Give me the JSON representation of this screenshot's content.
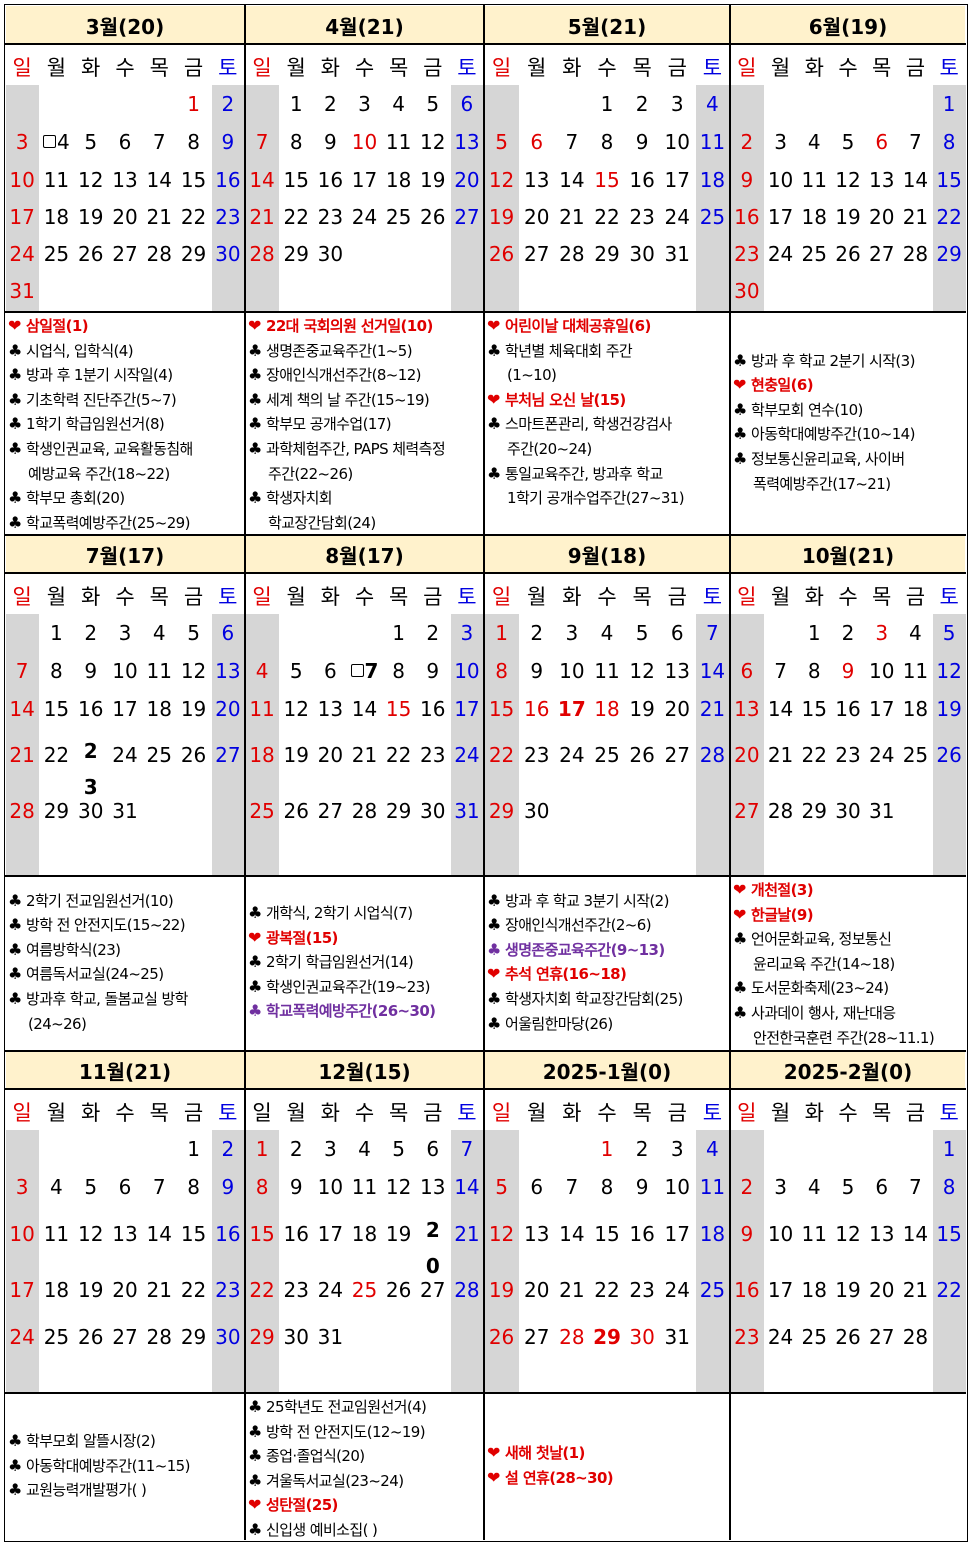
{
  "weekday_labels": [
    "일",
    "월",
    "화",
    "수",
    "목",
    "금",
    "토"
  ],
  "colors": {
    "header_bg": "#fff2cc",
    "weekend_column": "#d6d6d6",
    "holiday": "#e00000",
    "saturday": "#0000e0",
    "highlight_purple": "#7030a0"
  },
  "months": [
    {
      "title": "3월(20)",
      "sat_blue": true,
      "weeks": [
        [
          null,
          null,
          null,
          null,
          null,
          "1",
          "2"
        ],
        [
          "3",
          {
            "n": "4",
            "box": true
          },
          "5",
          "6",
          "7",
          "8",
          "9"
        ],
        [
          "10",
          "11",
          "12",
          "13",
          "14",
          "15",
          "16"
        ],
        [
          "17",
          "18",
          "19",
          "20",
          "21",
          "22",
          "23"
        ],
        [
          "24",
          "25",
          "26",
          "27",
          "28",
          "29",
          "30"
        ],
        [
          "31",
          null,
          null,
          null,
          null,
          null,
          null
        ]
      ],
      "red_days": [
        "1"
      ],
      "bold_days": []
    },
    {
      "title": "4월(21)",
      "sat_blue": true,
      "weeks": [
        [
          null,
          "1",
          "2",
          "3",
          "4",
          "5",
          "6"
        ],
        [
          "7",
          "8",
          "9",
          "10",
          "11",
          "12",
          "13"
        ],
        [
          "14",
          "15",
          "16",
          "17",
          "18",
          "19",
          "20"
        ],
        [
          "21",
          "22",
          "23",
          "24",
          "25",
          "26",
          "27"
        ],
        [
          "28",
          "29",
          "30",
          null,
          null,
          null,
          null
        ]
      ],
      "red_days": [
        "10"
      ],
      "bold_days": []
    },
    {
      "title": "5월(21)",
      "sat_blue": true,
      "weeks": [
        [
          null,
          null,
          null,
          "1",
          "2",
          "3",
          "4"
        ],
        [
          "5",
          "6",
          "7",
          "8",
          "9",
          "10",
          "11"
        ],
        [
          "12",
          "13",
          "14",
          "15",
          "16",
          "17",
          "18"
        ],
        [
          "19",
          "20",
          "21",
          "22",
          "23",
          "24",
          "25"
        ],
        [
          "26",
          "27",
          "28",
          "29",
          "30",
          "31",
          null
        ]
      ],
      "red_days": [
        "6",
        "15"
      ],
      "bold_days": []
    },
    {
      "title": "6월(19)",
      "sat_blue": true,
      "weeks": [
        [
          null,
          null,
          null,
          null,
          null,
          null,
          "1"
        ],
        [
          "2",
          "3",
          "4",
          "5",
          "6",
          "7",
          "8"
        ],
        [
          "9",
          "10",
          "11",
          "12",
          "13",
          "14",
          "15"
        ],
        [
          "16",
          "17",
          "18",
          "19",
          "20",
          "21",
          "22"
        ],
        [
          "23",
          "24",
          "25",
          "26",
          "27",
          "28",
          "29"
        ],
        [
          "30",
          null,
          null,
          null,
          null,
          null,
          null
        ]
      ],
      "red_days": [
        "6"
      ],
      "bold_days": []
    },
    {
      "title": "7월(17)",
      "sat_blue": true,
      "weeks": [
        [
          null,
          "1",
          "2",
          "3",
          "4",
          "5",
          "6"
        ],
        [
          "7",
          "8",
          "9",
          "10",
          "11",
          "12",
          "13"
        ],
        [
          "14",
          "15",
          "16",
          "17",
          "18",
          "19",
          "20"
        ],
        [
          "21",
          "22",
          {
            "n": "23",
            "split": [
              "2",
              "3"
            ],
            "bold": true
          },
          "24",
          "25",
          "26",
          "27"
        ],
        [
          "28",
          "29",
          "30",
          "31",
          null,
          null,
          null
        ]
      ],
      "red_days": [],
      "bold_days": [
        "23"
      ]
    },
    {
      "title": "8월(17)",
      "sat_blue": true,
      "weeks": [
        [
          null,
          null,
          null,
          null,
          "1",
          "2",
          "3"
        ],
        [
          "4",
          "5",
          "6",
          {
            "n": "7",
            "box": true,
            "bold": true
          },
          "8",
          "9",
          "10"
        ],
        [
          "11",
          "12",
          "13",
          "14",
          "15",
          "16",
          "17"
        ],
        [
          "18",
          "19",
          "20",
          "21",
          "22",
          "23",
          "24"
        ],
        [
          "25",
          "26",
          "27",
          "28",
          "29",
          "30",
          "31"
        ]
      ],
      "red_days": [
        "15"
      ],
      "bold_days": [
        "7"
      ]
    },
    {
      "title": "9월(18)",
      "sat_blue": true,
      "weeks": [
        [
          "1",
          "2",
          "3",
          "4",
          "5",
          "6",
          "7"
        ],
        [
          "8",
          "9",
          "10",
          "11",
          "12",
          "13",
          "14"
        ],
        [
          "15",
          "16",
          "17",
          "18",
          "19",
          "20",
          "21"
        ],
        [
          "22",
          "23",
          "24",
          "25",
          "26",
          "27",
          "28"
        ],
        [
          "29",
          "30",
          null,
          null,
          null,
          null,
          null
        ]
      ],
      "red_days": [
        "16",
        "17",
        "18"
      ],
      "bold_days": [
        "17"
      ]
    },
    {
      "title": "10월(21)",
      "sat_blue": true,
      "weeks": [
        [
          null,
          null,
          "1",
          "2",
          "3",
          "4",
          "5"
        ],
        [
          "6",
          "7",
          "8",
          "9",
          "10",
          "11",
          "12"
        ],
        [
          "13",
          "14",
          "15",
          "16",
          "17",
          "18",
          "19"
        ],
        [
          "20",
          "21",
          "22",
          "23",
          "24",
          "25",
          "26"
        ],
        [
          "27",
          "28",
          "29",
          "30",
          "31",
          null,
          null
        ]
      ],
      "red_days": [
        "3",
        "9"
      ],
      "bold_days": []
    },
    {
      "title": "11월(21)",
      "sat_blue": true,
      "weeks": [
        [
          null,
          null,
          null,
          null,
          null,
          "1",
          "2"
        ],
        [
          "3",
          "4",
          "5",
          "6",
          "7",
          "8",
          "9"
        ],
        [
          "10",
          "11",
          "12",
          "13",
          "14",
          "15",
          "16"
        ],
        [
          "17",
          "18",
          "19",
          "20",
          "21",
          "22",
          "23"
        ],
        [
          "24",
          "25",
          "26",
          "27",
          "28",
          "29",
          "30"
        ]
      ],
      "red_days": [],
      "bold_days": []
    },
    {
      "title": "12월(15)",
      "sat_blue": true,
      "sun_black_label": true,
      "weeks": [
        [
          "1",
          "2",
          "3",
          "4",
          "5",
          "6",
          "7"
        ],
        [
          "8",
          "9",
          "10",
          "11",
          "12",
          "13",
          "14"
        ],
        [
          "15",
          "16",
          "17",
          "18",
          "19",
          {
            "n": "20",
            "split": [
              "2",
              "0"
            ],
            "bold": true
          },
          "21"
        ],
        [
          "22",
          "23",
          "24",
          "25",
          "26",
          "27",
          "28"
        ],
        [
          "29",
          "30",
          "31",
          null,
          null,
          null,
          null
        ]
      ],
      "red_days": [
        "25"
      ],
      "bold_days": [
        "20"
      ]
    },
    {
      "title": "2025-1월(0)",
      "sat_blue": true,
      "weeks": [
        [
          null,
          null,
          null,
          "1",
          "2",
          "3",
          "4"
        ],
        [
          "5",
          "6",
          "7",
          "8",
          "9",
          "10",
          "11"
        ],
        [
          "12",
          "13",
          "14",
          "15",
          "16",
          "17",
          "18"
        ],
        [
          "19",
          "20",
          "21",
          "22",
          "23",
          "24",
          "25"
        ],
        [
          "26",
          "27",
          "28",
          "29",
          "30",
          "31",
          null
        ]
      ],
      "red_days": [
        "1",
        "28",
        "29",
        "30"
      ],
      "bold_days": [
        "29"
      ]
    },
    {
      "title": "2025-2월(0)",
      "sat_blue": true,
      "weeks": [
        [
          null,
          null,
          null,
          null,
          null,
          null,
          "1"
        ],
        [
          "2",
          "3",
          "4",
          "5",
          "6",
          "7",
          "8"
        ],
        [
          "9",
          "10",
          "11",
          "12",
          "13",
          "14",
          "15"
        ],
        [
          "16",
          "17",
          "18",
          "19",
          "20",
          "21",
          "22"
        ],
        [
          "23",
          "24",
          "25",
          "26",
          "27",
          "28",
          null
        ]
      ],
      "red_days": [],
      "bold_days": []
    }
  ],
  "events": [
    [
      {
        "icon": "heart",
        "text": "삼일절(1)",
        "style": "red"
      },
      {
        "icon": "club",
        "text": "시업식, 입학식(4)"
      },
      {
        "icon": "club",
        "text": "방과 후 1분기 시작일(4)"
      },
      {
        "icon": "club",
        "text": "기초학력 진단주간(5~7)"
      },
      {
        "icon": "club",
        "text": "1학기 학급임원선거(8)"
      },
      {
        "icon": "club",
        "text": "학생인권교육, 교육활동침해"
      },
      {
        "icon": "",
        "text": "예방교육 주간(18~22)"
      },
      {
        "icon": "club",
        "text": "학부모 총회(20)"
      },
      {
        "icon": "club",
        "text": "학교폭력예방주간(25~29)"
      }
    ],
    [
      {
        "icon": "heart",
        "text": "22대 국회의원 선거일(10)",
        "style": "red"
      },
      {
        "icon": "club",
        "text": "생명존중교육주간(1~5)"
      },
      {
        "icon": "club",
        "text": "장애인식개선주간(8~12)"
      },
      {
        "icon": "club",
        "text": "세계 책의 날 주간(15~19)"
      },
      {
        "icon": "club",
        "text": "학부모 공개수업(17)"
      },
      {
        "icon": "club",
        "text": "과학체험주간, PAPS 체력측정"
      },
      {
        "icon": "",
        "text": "주간(22~26)"
      },
      {
        "icon": "club",
        "text": "학생자치회"
      },
      {
        "icon": "",
        "text": "학교장간담회(24)"
      }
    ],
    [
      {
        "icon": "heart",
        "text": "어린이날 대체공휴일(6)",
        "style": "red"
      },
      {
        "icon": "club",
        "text": "학년별 체육대회 주간"
      },
      {
        "icon": "",
        "text": "(1~10)"
      },
      {
        "icon": "heart",
        "text": "부처님 오신 날(15)",
        "style": "red"
      },
      {
        "icon": "club",
        "text": "스마트폰관리, 학생건강검사"
      },
      {
        "icon": "",
        "text": "주간(20~24)"
      },
      {
        "icon": "club",
        "text": "통일교육주간, 방과후 학교"
      },
      {
        "icon": "",
        "text": "1학기 공개수업주간(27~31)"
      }
    ],
    [
      {
        "icon": "club",
        "text": "방과 후 학교 2분기 시작(3)"
      },
      {
        "icon": "heart",
        "text": "현충일(6)",
        "style": "red"
      },
      {
        "icon": "club",
        "text": "학부모회 연수(10)"
      },
      {
        "icon": "club",
        "text": "아동학대예방주간(10~14)"
      },
      {
        "icon": "club",
        "text": "정보통신윤리교육, 사이버"
      },
      {
        "icon": "",
        "text": "폭력예방주간(17~21)"
      }
    ],
    [
      {
        "icon": "club",
        "text": "2학기 전교임원선거(10)"
      },
      {
        "icon": "club",
        "text": "방학 전 안전지도(15~22)"
      },
      {
        "icon": "club",
        "text": "여름방학식(23)"
      },
      {
        "icon": "club",
        "text": "여름독서교실(24~25)"
      },
      {
        "icon": "club",
        "text": "방과후 학교, 돌봄교실 방학"
      },
      {
        "icon": "",
        "text": "(24~26)"
      }
    ],
    [
      {
        "icon": "club",
        "text": "개학식, 2학기 시업식(7)"
      },
      {
        "icon": "heart",
        "text": "광복절(15)",
        "style": "red"
      },
      {
        "icon": "club",
        "text": "2학기 학급임원선거(14)"
      },
      {
        "icon": "club",
        "text": "학생인권교육주간(19~23)"
      },
      {
        "icon": "clubp",
        "text": "학교폭력예방주간(26~30)",
        "style": "purple"
      }
    ],
    [
      {
        "icon": "club",
        "text": "방과 후 학교 3분기 시작(2)"
      },
      {
        "icon": "club",
        "text": "장애인식개선주간(2~6)"
      },
      {
        "icon": "clubp",
        "text": "생명존중교육주간(9~13)",
        "style": "purple"
      },
      {
        "icon": "heart",
        "text": "추석 연휴(16~18)",
        "style": "red"
      },
      {
        "icon": "club",
        "text": "학생자치회 학교장간담회(25)"
      },
      {
        "icon": "club",
        "text": "어울림한마당(26)"
      }
    ],
    [
      {
        "icon": "heart",
        "text": "개천절(3)",
        "style": "red"
      },
      {
        "icon": "heart",
        "text": "한글날(9)",
        "style": "red"
      },
      {
        "icon": "club",
        "text": "언어문화교육, 정보통신"
      },
      {
        "icon": "",
        "text": "윤리교육 주간(14~18)"
      },
      {
        "icon": "club",
        "text": "도서문화축제(23~24)"
      },
      {
        "icon": "club",
        "text": "사과데이 행사, 재난대응"
      },
      {
        "icon": "",
        "text": "안전한국훈련 주간(28~11.1)"
      }
    ],
    [
      {
        "icon": "club",
        "text": "학부모회 알뜰시장(2)"
      },
      {
        "icon": "club",
        "text": "아동학대예방주간(11~15)"
      },
      {
        "icon": "club",
        "text": "교원능력개발평가( )"
      }
    ],
    [
      {
        "icon": "club",
        "text": "25학년도 전교임원선거(4)"
      },
      {
        "icon": "club",
        "text": "방학 전 안전지도(12~19)"
      },
      {
        "icon": "club",
        "text": "종업·졸업식(20)"
      },
      {
        "icon": "club",
        "text": "겨울독서교실(23~24)"
      },
      {
        "icon": "heart",
        "text": "성탄절(25)",
        "style": "red"
      },
      {
        "icon": "club",
        "text": "신입생 예비소집( )"
      }
    ],
    [
      {
        "icon": "heart",
        "text": "새해 첫날(1)",
        "style": "red"
      },
      {
        "icon": "heart",
        "text": "설 연휴(28~30)",
        "style": "red"
      }
    ],
    []
  ]
}
